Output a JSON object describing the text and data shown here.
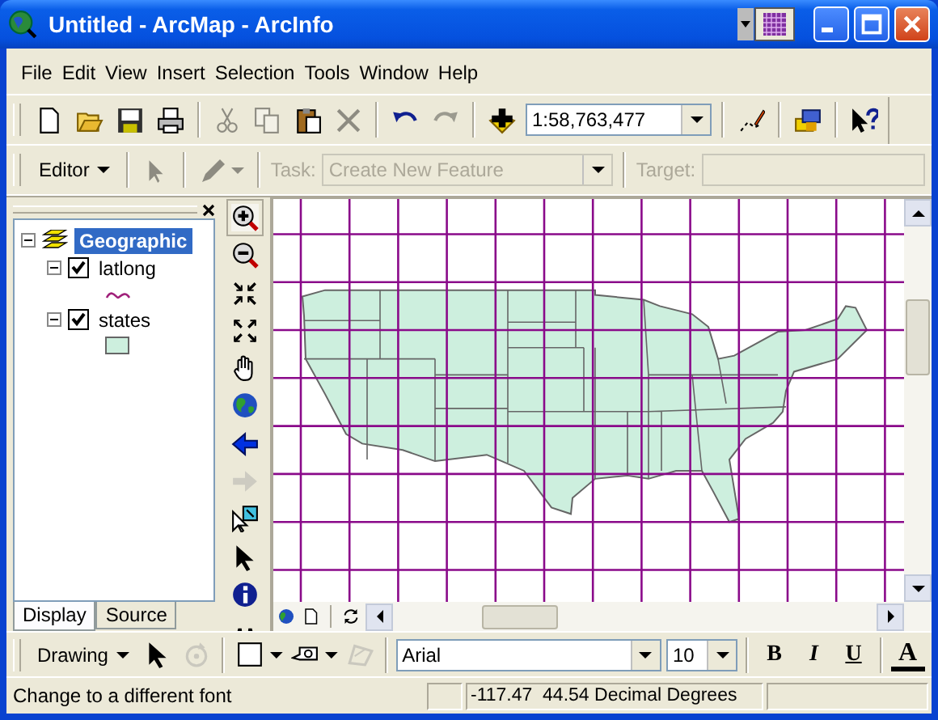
{
  "window": {
    "title": "Untitled - ArcMap - ArcInfo"
  },
  "menu": [
    "File",
    "Edit",
    "View",
    "Insert",
    "Selection",
    "Tools",
    "Window",
    "Help"
  ],
  "standard_toolbar": {
    "scale": "1:58,763,477",
    "buttons": [
      {
        "disabled": false
      },
      {
        "disabled": false
      },
      {
        "disabled": false
      },
      {
        "disabled": false
      },
      {
        "disabled": true
      },
      {
        "disabled": true
      },
      {
        "disabled": false
      },
      {
        "disabled": true
      },
      {
        "disabled": false
      },
      {
        "disabled": true
      },
      {
        "disabled": false
      },
      {
        "disabled": false
      },
      {
        "disabled": false
      },
      {
        "disabled": false
      }
    ]
  },
  "editor_toolbar": {
    "menu": "Editor",
    "disabled": true,
    "task_label": "Task:",
    "task": "Create New Feature",
    "target_label": "Target:"
  },
  "toc": {
    "layers": [
      {
        "name": "Geographic",
        "kind": "frame",
        "selected": true,
        "expanded": true,
        "children": [
          {
            "name": "latlong",
            "kind": "line",
            "checked": true,
            "expanded": true
          },
          {
            "name": "states",
            "kind": "polygon",
            "checked": true,
            "expanded": true
          }
        ]
      }
    ],
    "tabs": [
      {
        "label": "Display",
        "selected": true
      },
      {
        "label": "Source",
        "selected": false
      }
    ]
  },
  "tools": [
    {
      "disabled": false
    },
    {
      "disabled": false
    },
    {
      "disabled": false
    },
    {
      "disabled": false
    },
    {
      "disabled": false
    },
    {
      "disabled": false
    },
    {
      "disabled": false
    },
    {
      "disabled": true
    },
    {
      "disabled": false
    },
    {
      "disabled": false
    },
    {
      "disabled": false
    },
    {
      "disabled": false
    }
  ],
  "drawing_toolbar": {
    "menu": "Drawing",
    "buttons": [
      {
        "disabled": false
      },
      {
        "disabled": true
      },
      {
        "disabled": false
      },
      {
        "disabled": false
      },
      {
        "disabled": true
      }
    ],
    "font": "Arial",
    "size": "10",
    "styles": [
      "B",
      "I",
      "U"
    ],
    "color_letter": "A"
  },
  "status_bar": {
    "message": "Change to a different font",
    "coordinates": "-117.47  44.54 Decimal Degrees"
  }
}
